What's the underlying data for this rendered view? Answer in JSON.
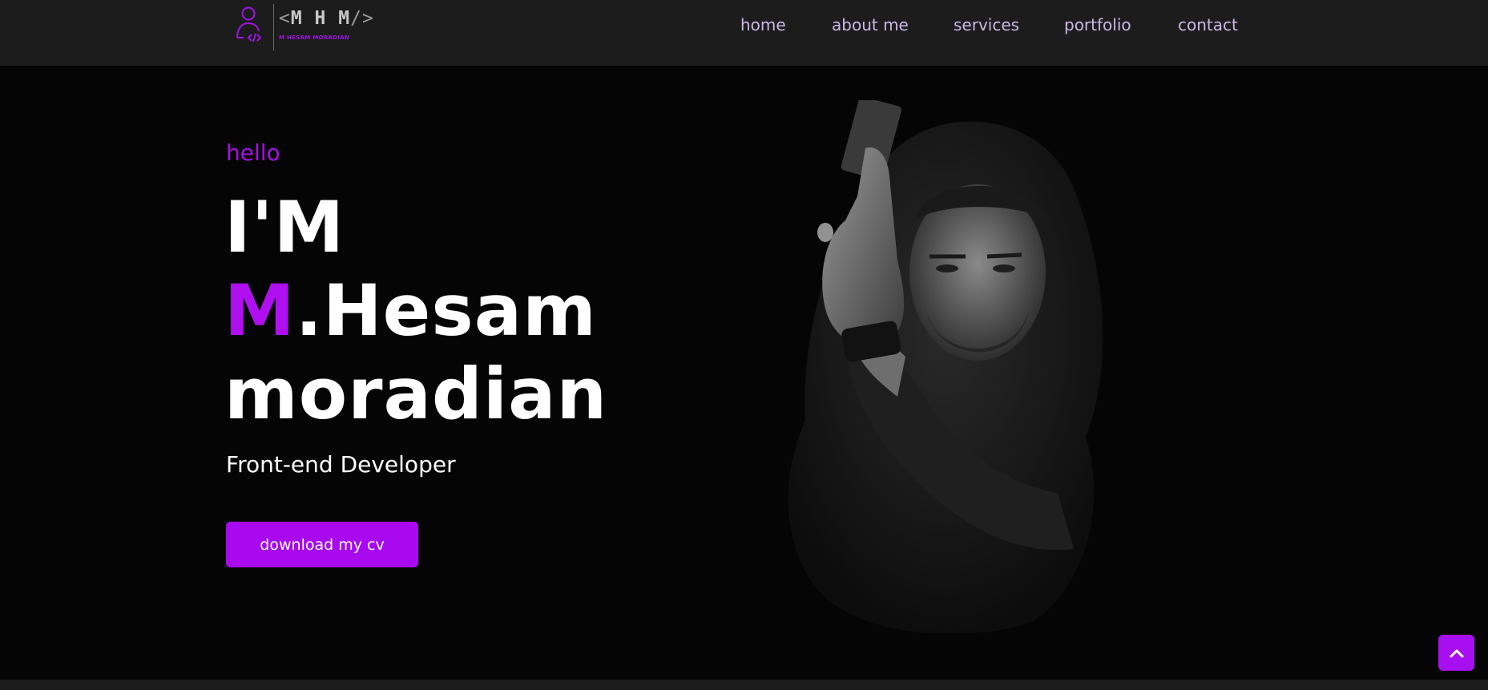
{
  "header": {
    "logo": {
      "mark_open": "<",
      "mark_letters": "M H M",
      "mark_close": "/>",
      "subtitle": "M HESAM MORADIAN",
      "icon": "developer-user-code-icon"
    },
    "nav": [
      {
        "label": "home"
      },
      {
        "label": "about me"
      },
      {
        "label": "services"
      },
      {
        "label": "portfolio"
      },
      {
        "label": "contact"
      }
    ]
  },
  "hero": {
    "greeting": "hello",
    "title_line1": "I'M",
    "title_accent": "M",
    "title_line2_rest": ".Hesam",
    "title_line3": "moradian",
    "role": "Front-end Developer",
    "cta_label": "download my cv",
    "image": "portrait-photo"
  },
  "scroll_top": {
    "icon": "chevron-up-icon"
  },
  "colors": {
    "accent": "#a80ff0",
    "header_bg": "#1c1c1d",
    "page_bg": "#050505",
    "nav_text": "#cdb7e6",
    "text": "#ffffff"
  }
}
